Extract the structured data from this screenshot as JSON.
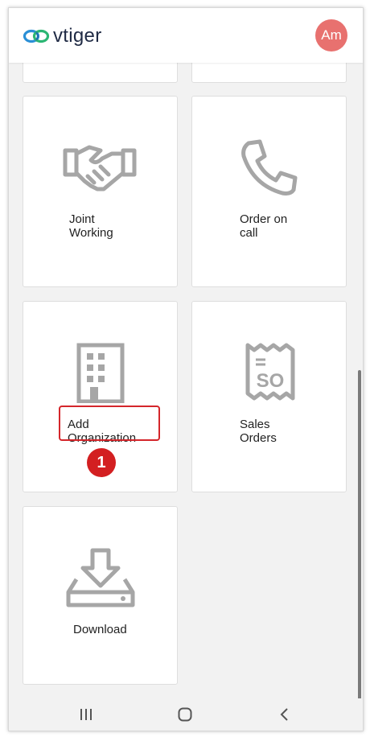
{
  "app": {
    "logo_text": "vtiger",
    "user_initials": "Am"
  },
  "colors": {
    "accent_avatar": "#e8716f",
    "step_badge": "#d31f21",
    "icon_gray": "#a6a6a6"
  },
  "tiles": [
    {
      "label": "Joint\nWorking",
      "icon": "handshake-icon"
    },
    {
      "label": "Order on\ncall",
      "icon": "phone-icon"
    },
    {
      "label": "Add\nOrganization",
      "icon": "building-icon"
    },
    {
      "label": "Sales\nOrders",
      "icon": "receipt-so-icon",
      "icon_text": "SO"
    },
    {
      "label": "Download",
      "icon": "download-icon"
    }
  ],
  "annotation": {
    "step": "1"
  },
  "navbar": {
    "recent": "recent-apps-icon",
    "home": "home-icon",
    "back": "back-icon"
  }
}
